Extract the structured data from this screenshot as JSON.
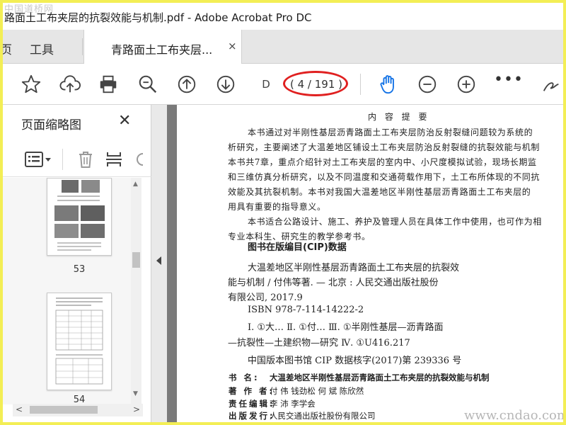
{
  "window": {
    "title": "路面土工布夹层的抗裂效能与机制.pdf - Adobe Acrobat Pro DC",
    "site_watermark": "中国道桥网"
  },
  "tabs": {
    "home_partial": "页",
    "tools": "工具",
    "document": "青路面土工布夹层...",
    "close": "×"
  },
  "toolbar": {
    "icons": [
      "star-icon",
      "cloud-upload-icon",
      "print-icon",
      "zoom-search-icon",
      "page-up-icon",
      "page-down-icon",
      "hand-tool-icon",
      "zoom-out-icon",
      "zoom-in-icon",
      "more-icon",
      "sign-icon"
    ],
    "page_input": "D",
    "page_count": "( 4 / 191 )",
    "more": "•••",
    "highlight_color": "#e02020",
    "accent_color": "#1473e6"
  },
  "left_panel": {
    "title": "页面缩略图",
    "close": "✕",
    "thumbnails": [
      {
        "label": "53"
      },
      {
        "label": "54"
      }
    ]
  },
  "document": {
    "heading": "内 容 提 要",
    "summary": [
      "本书通过对半刚性基层沥青路面土工布夹层防治反射裂缝问题较为系统的",
      "析研究，主要阐述了大温差地区铺设土工布夹层防治反射裂缝的抗裂效能与机制",
      "本书共7章，重点介绍针对土工布夹层的室内中、小尺度模拟试验，现场长期监",
      "和三维仿真分析研究，以及不同温度和交通荷载作用下，土工布所体现的不同抗",
      "效能及其抗裂机制。本书对我国大温差地区半刚性基层沥青路面土工布夹层的",
      "用具有重要的指导意义。",
      "本书适合公路设计、施工、养护及管理人员在具体工作中使用，也可作为相",
      "专业本科生、研究生的教学参考书。"
    ],
    "cip_title": "图书在版编目(CIP)数据",
    "cip_lines": [
      "大温差地区半刚性基层沥青路面土工布夹层的抗裂效",
      "能与机制 / 付伟等著. — 北京 : 人民交通出版社股份",
      "有限公司, 2017.9",
      "ISBN 978-7-114-14222-2",
      "Ⅰ. ①大…   Ⅱ. ①付…   Ⅲ. ①半刚性基层—沥青路面",
      "—抗裂性—土建织物—研究   Ⅳ. ①U416.217",
      "中国版本图书馆 CIP 数据核字(2017)第 239336 号"
    ],
    "meta": [
      {
        "key": "书    名:",
        "value": "大温差地区半刚性基层沥青路面土工布夹层的抗裂效能与机制"
      },
      {
        "key": "著 作 者:",
        "value": "付  伟   钱劲松   何  斌   陈欣然"
      },
      {
        "key": "责任编辑:",
        "value": "李  沛   李学会"
      },
      {
        "key": "出版发行:",
        "value": "人民交通出版社股份有限公司"
      }
    ]
  },
  "watermark": "www.cndao.com"
}
